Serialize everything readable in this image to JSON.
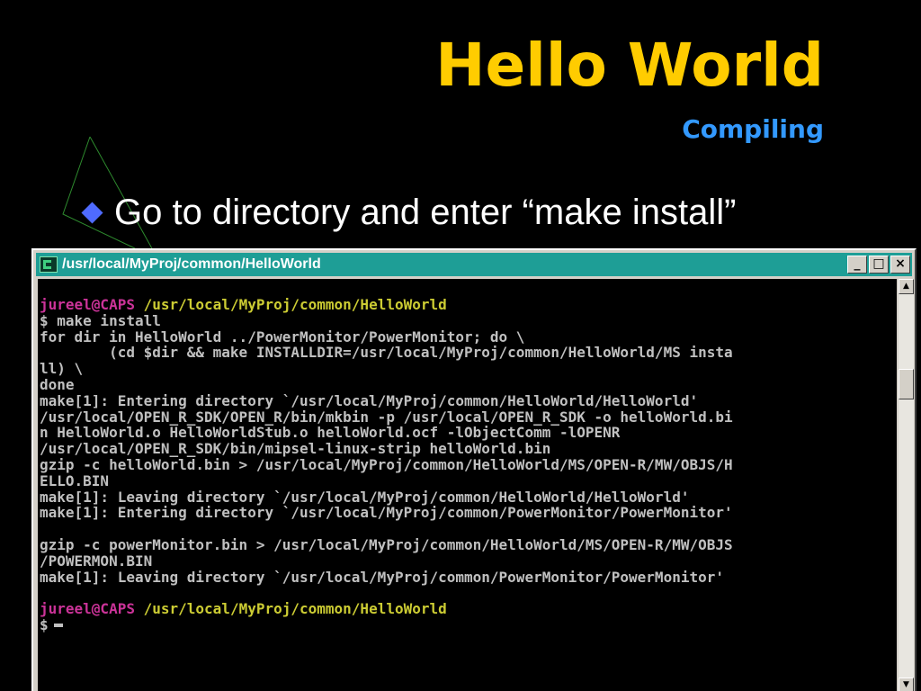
{
  "slide": {
    "title": "Hello World",
    "subtitle": "Compiling",
    "bullet": "Go to directory and enter “make install”",
    "colors": {
      "background": "#000000",
      "title": "#FFCC00",
      "subtitle": "#3399FF",
      "bullet_text": "#FFFFFF",
      "bullet_marker": "#4F6BFF",
      "deco_lines": "#2E8B2E"
    }
  },
  "terminal": {
    "window_title": "/usr/local/MyProj/common/HelloWorld",
    "icon": "terminal-app-icon",
    "buttons": {
      "minimize": "_",
      "maximize": "□",
      "close": "×"
    },
    "scroll_up_glyph": "▲",
    "scroll_down_glyph": "▼",
    "colors": {
      "titlebar": "#1E9E96",
      "console_bg": "#000000",
      "console_text": "#C0C0C0",
      "prompt_user": "#CC3399",
      "prompt_path": "#CCCC33"
    },
    "prompt1": {
      "user": "jureel@CAPS",
      "path": "/usr/local/MyProj/common/HelloWorld"
    },
    "lines": [
      "$ make install",
      "for dir in HelloWorld ../PowerMonitor/PowerMonitor; do \\",
      "        (cd $dir && make INSTALLDIR=/usr/local/MyProj/common/HelloWorld/MS insta",
      "ll) \\",
      "done",
      "make[1]: Entering directory `/usr/local/MyProj/common/HelloWorld/HelloWorld'",
      "/usr/local/OPEN_R_SDK/OPEN_R/bin/mkbin -p /usr/local/OPEN_R_SDK -o helloWorld.bi",
      "n HelloWorld.o HelloWorldStub.o helloWorld.ocf -lObjectComm -lOPENR",
      "/usr/local/OPEN_R_SDK/bin/mipsel-linux-strip helloWorld.bin",
      "gzip -c helloWorld.bin > /usr/local/MyProj/common/HelloWorld/MS/OPEN-R/MW/OBJS/H",
      "ELLO.BIN",
      "make[1]: Leaving directory `/usr/local/MyProj/common/HelloWorld/HelloWorld'",
      "make[1]: Entering directory `/usr/local/MyProj/common/PowerMonitor/PowerMonitor'",
      "",
      "gzip -c powerMonitor.bin > /usr/local/MyProj/common/HelloWorld/MS/OPEN-R/MW/OBJS",
      "/POWERMON.BIN",
      "make[1]: Leaving directory `/usr/local/MyProj/common/PowerMonitor/PowerMonitor'",
      ""
    ],
    "prompt2": {
      "user": "jureel@CAPS",
      "path": "/usr/local/MyProj/common/HelloWorld"
    },
    "final_prompt": "$"
  }
}
